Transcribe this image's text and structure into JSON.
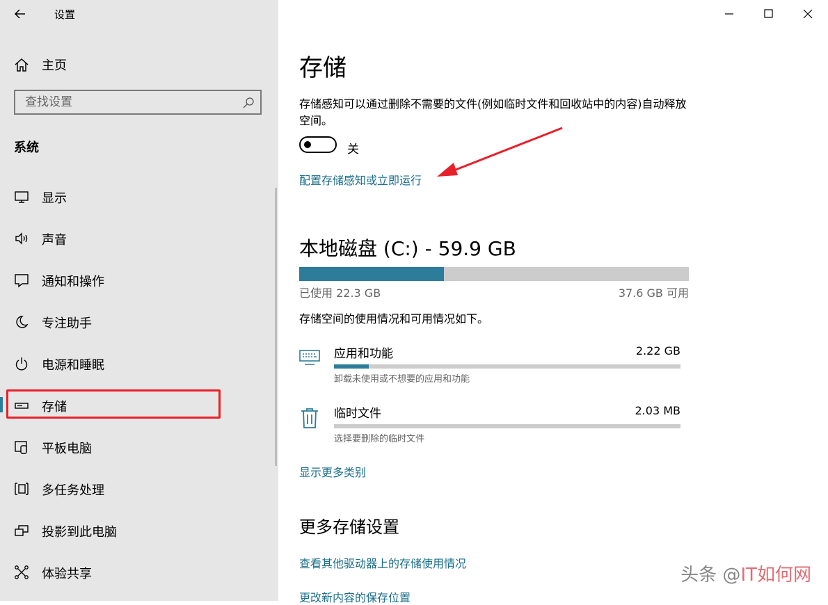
{
  "app_title": "设置",
  "home_label": "主页",
  "search_placeholder": "查找设置",
  "section_title": "系统",
  "nav": [
    {
      "label": "显示",
      "icon": "display-icon"
    },
    {
      "label": "声音",
      "icon": "sound-icon"
    },
    {
      "label": "通知和操作",
      "icon": "notification-icon"
    },
    {
      "label": "专注助手",
      "icon": "moon-icon"
    },
    {
      "label": "电源和睡眠",
      "icon": "power-icon"
    },
    {
      "label": "存储",
      "icon": "storage-icon",
      "active": true
    },
    {
      "label": "平板电脑",
      "icon": "tablet-icon"
    },
    {
      "label": "多任务处理",
      "icon": "multitask-icon"
    },
    {
      "label": "投影到此电脑",
      "icon": "project-icon"
    },
    {
      "label": "体验共享",
      "icon": "share-icon"
    }
  ],
  "page_title": "存储",
  "storage_sense_desc": "存储感知可以通过删除不需要的文件(例如临时文件和回收站中的内容)自动释放空间。",
  "toggle_state": "关",
  "configure_link": "配置存储感知或立即运行",
  "disk": {
    "title": "本地磁盘 (C:) - 59.9 GB",
    "used_label": "已使用 22.3 GB",
    "free_label": "37.6 GB 可用",
    "used_fraction": 0.372
  },
  "usage_desc": "存储空间的使用情况和可用情况如下。",
  "categories": [
    {
      "name": "应用和功能",
      "size": "2.22 GB",
      "sub": "卸载未使用或不想要的应用和功能",
      "fraction": 0.1,
      "icon": "keyboard-icon"
    },
    {
      "name": "临时文件",
      "size": "2.03 MB",
      "sub": "选择要删除的临时文件",
      "fraction": 0.0,
      "icon": "trash-icon"
    }
  ],
  "show_more_link": "显示更多类别",
  "more_settings_title": "更多存储设置",
  "more_links": [
    "查看其他驱动器上的存储使用情况",
    "更改新内容的保存位置"
  ],
  "watermark": {
    "part1": "头条 @",
    "part2": "IT如何网"
  },
  "colors": {
    "accent": "#2d7d9a",
    "highlight": "#e8202a",
    "sidebar_bg": "#e6e6e6"
  }
}
